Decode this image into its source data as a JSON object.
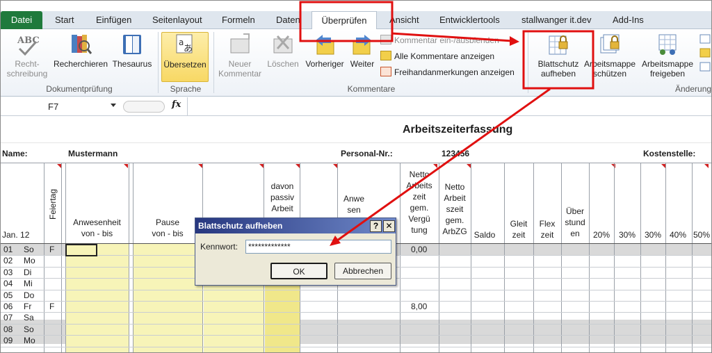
{
  "tabs": {
    "file": "Datei",
    "start": "Start",
    "insert": "Einfügen",
    "page_layout": "Seitenlayout",
    "formulas": "Formeln",
    "data": "Daten",
    "review": "Überprüfen",
    "view": "Ansicht",
    "developer": "Entwicklertools",
    "custom": "stallwanger it.dev",
    "addins": "Add-Ins"
  },
  "ribbon": {
    "spelling": "Recht-\nschreibung",
    "research": "Recherchieren",
    "thesaurus": "Thesaurus",
    "translate": "Übersetzen",
    "new_comment": "Neuer\nKommentar",
    "delete": "Löschen",
    "previous": "Vorheriger",
    "next": "Weiter",
    "toggle_comment": "Kommentar ein-/ausblenden",
    "show_all_comments": "Alle Kommentare anzeigen",
    "show_ink": "Freihandanmerkungen anzeigen",
    "unprotect_sheet": "Blattschutz\naufheben",
    "protect_workbook": "Arbeitsmappe\nschützen",
    "share_workbook": "Arbeitsmappe\nfreigeben",
    "group_proofing": "Dokumentprüfung",
    "group_language": "Sprache",
    "group_comments": "Kommentare",
    "group_changes": "Änderungen"
  },
  "formula_bar": {
    "cell_ref": "F7",
    "fx": "fx"
  },
  "sheet": {
    "title": "Arbeitszeiterfassung",
    "name_label": "Name:",
    "name_value": "Mustermann",
    "personal_label": "Personal-Nr.:",
    "personal_value": "123456",
    "cost_label": "Kostenstelle:",
    "headers": {
      "month": "Jan. 12",
      "holiday": "Feiertag",
      "presence": "Anwesenheit\nvon - bis",
      "pause": "Pause\nvon - bis",
      "passive": "davon\npassiv\nArbeit",
      "anwesen": "Anwe\nsen",
      "netto_verg": "Netto\nArbeits\nzeit\ngem.\nVergü\ntung",
      "netto_arbzg": "Netto\nArbeit\nszeit\ngem.\nArbZG",
      "saldo": "Saldo",
      "gleit": "Gleit\nzeit",
      "flex": "Flex\nzeit",
      "ueber": "Über\nstund\nen",
      "p20": "20%",
      "p30a": "30%",
      "p30b": "30%",
      "p40": "40%",
      "p50": "50%"
    },
    "rows": [
      {
        "day": "01",
        "wd": "So",
        "holiday": "F",
        "netto": "0,00"
      },
      {
        "day": "02",
        "wd": "Mo",
        "holiday": "",
        "netto": ""
      },
      {
        "day": "03",
        "wd": "Di",
        "holiday": "",
        "netto": ""
      },
      {
        "day": "04",
        "wd": "Mi",
        "holiday": "",
        "netto": ""
      },
      {
        "day": "05",
        "wd": "Do",
        "holiday": "",
        "netto": ""
      },
      {
        "day": "06",
        "wd": "Fr",
        "holiday": "F",
        "netto": "8,00"
      },
      {
        "day": "07",
        "wd": "Sa",
        "holiday": "",
        "netto": ""
      },
      {
        "day": "08",
        "wd": "So",
        "holiday": "",
        "netto": ""
      },
      {
        "day": "09",
        "wd": "Mo",
        "holiday": "",
        "netto": ""
      }
    ]
  },
  "dialog": {
    "title": "Blattschutz aufheben",
    "help": "?",
    "close": "✕",
    "password_label": "Kennwort:",
    "password_value": "*************",
    "ok": "OK",
    "cancel": "Abbrechen"
  },
  "colors": {
    "file_tab": "#1f7a3c",
    "annotation": "#e01010",
    "dialog_title": "#27377f",
    "cell_yellow": "#f7f4b8"
  }
}
